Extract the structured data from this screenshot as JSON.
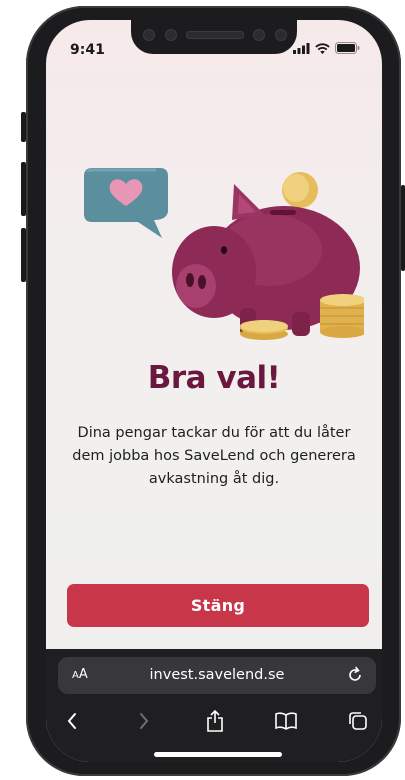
{
  "status_bar": {
    "time": "9:41"
  },
  "modal": {
    "title": "Bra val!",
    "message": "Dina pengar tackar du för att du låter dem jobba hos SaveLend och generera avkastning åt dig.",
    "close_label": "Stäng"
  },
  "browser": {
    "aa_label_big": "A",
    "aa_label_small": "A",
    "url": "invest.savelend.se"
  },
  "colors": {
    "title": "#6b1840",
    "button": "#c8364a",
    "pig": "#8e2a56",
    "bubble": "#5b8f9d",
    "coin": "#e6bd5a"
  },
  "icons": [
    "heart-icon",
    "reload-icon",
    "back-icon",
    "forward-icon",
    "share-icon",
    "bookmarks-icon",
    "tabs-icon",
    "signal-icon",
    "wifi-icon",
    "battery-icon"
  ]
}
